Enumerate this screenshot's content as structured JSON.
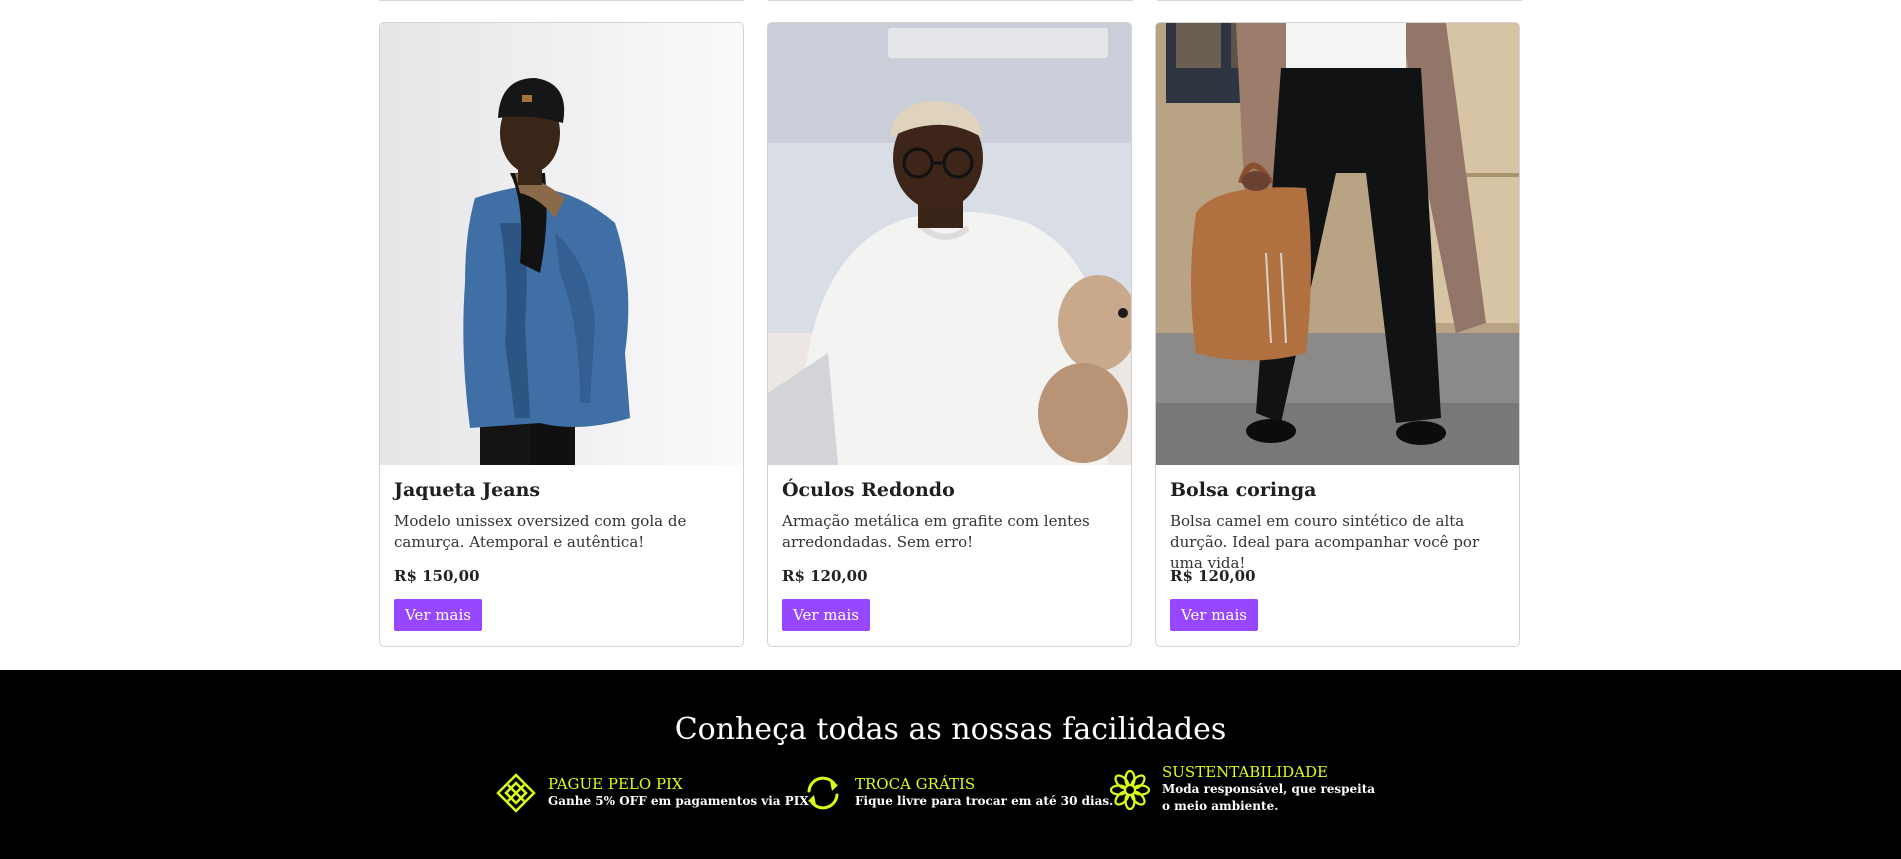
{
  "products": [
    {
      "name": "Jaqueta Jeans",
      "description": "Modelo unissex oversized com gola de camurça. Atemporal e autêntica!",
      "price": "R$ 150,00",
      "button_label": "Ver mais"
    },
    {
      "name": "Óculos Redondo",
      "description": "Armação metálica em grafite com lentes arredondadas. Sem erro!",
      "price": "R$ 120,00",
      "button_label": "Ver mais"
    },
    {
      "name": "Bolsa coringa",
      "description": "Bolsa camel em couro sintético de alta durção. Ideal para acompanhar você por uma vida!",
      "price": "R$ 120,00",
      "button_label": "Ver mais"
    }
  ],
  "footer": {
    "title": "Conheça todas as nossas facilidades",
    "features": [
      {
        "icon": "pix-icon",
        "title": "PAGUE PELO PIX",
        "description": "Ganhe 5% OFF em pagamentos via PIX"
      },
      {
        "icon": "exchange-icon",
        "title": "TROCA GRÁTIS",
        "description": "Fique livre para trocar em até 30 dias."
      },
      {
        "icon": "flower-icon",
        "title": "SUSTENTABILIDADE",
        "description": "Moda responsável, que respeita o meio ambiente."
      }
    ]
  },
  "colors": {
    "accent": "#9747ff",
    "footer_bg": "#000000",
    "highlight": "#d7ff19"
  }
}
